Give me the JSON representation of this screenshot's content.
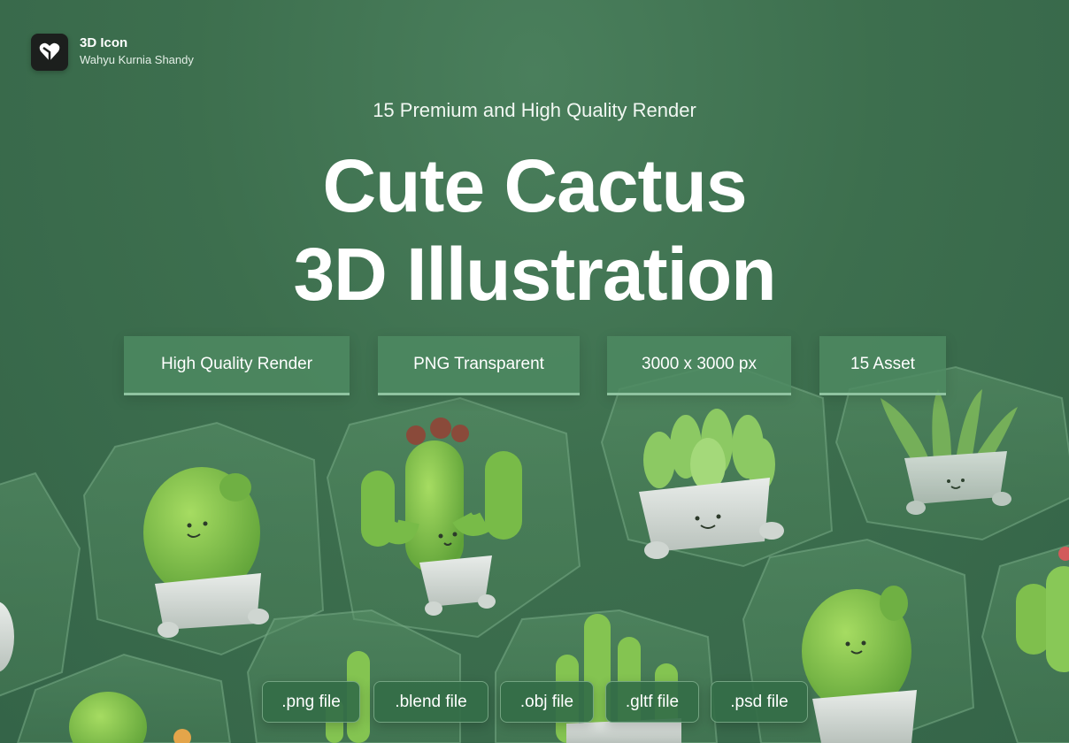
{
  "brand": {
    "title": "3D Icon",
    "author": "Wahyu Kurnia Shandy",
    "logo_icon": "heart-logo-icon"
  },
  "header": {
    "subtitle": "15 Premium and High Quality Render",
    "headline_line1": "Cute Cactus",
    "headline_line2": "3D Illustration"
  },
  "features": [
    {
      "label": "High Quality Render"
    },
    {
      "label": "PNG Transparent"
    },
    {
      "label": "3000 x 3000 px"
    },
    {
      "label": "15 Asset"
    }
  ],
  "file_formats": [
    {
      "label": ".png file"
    },
    {
      "label": ".blend file"
    },
    {
      "label": ".obj file"
    },
    {
      "label": ".gltf file"
    },
    {
      "label": ".psd file"
    }
  ],
  "colors": {
    "background": "#3d6f4e",
    "tag_fill": "#4e8a62",
    "cactus_green": "#7cc447",
    "pot_gray": "#d7ddd8"
  }
}
